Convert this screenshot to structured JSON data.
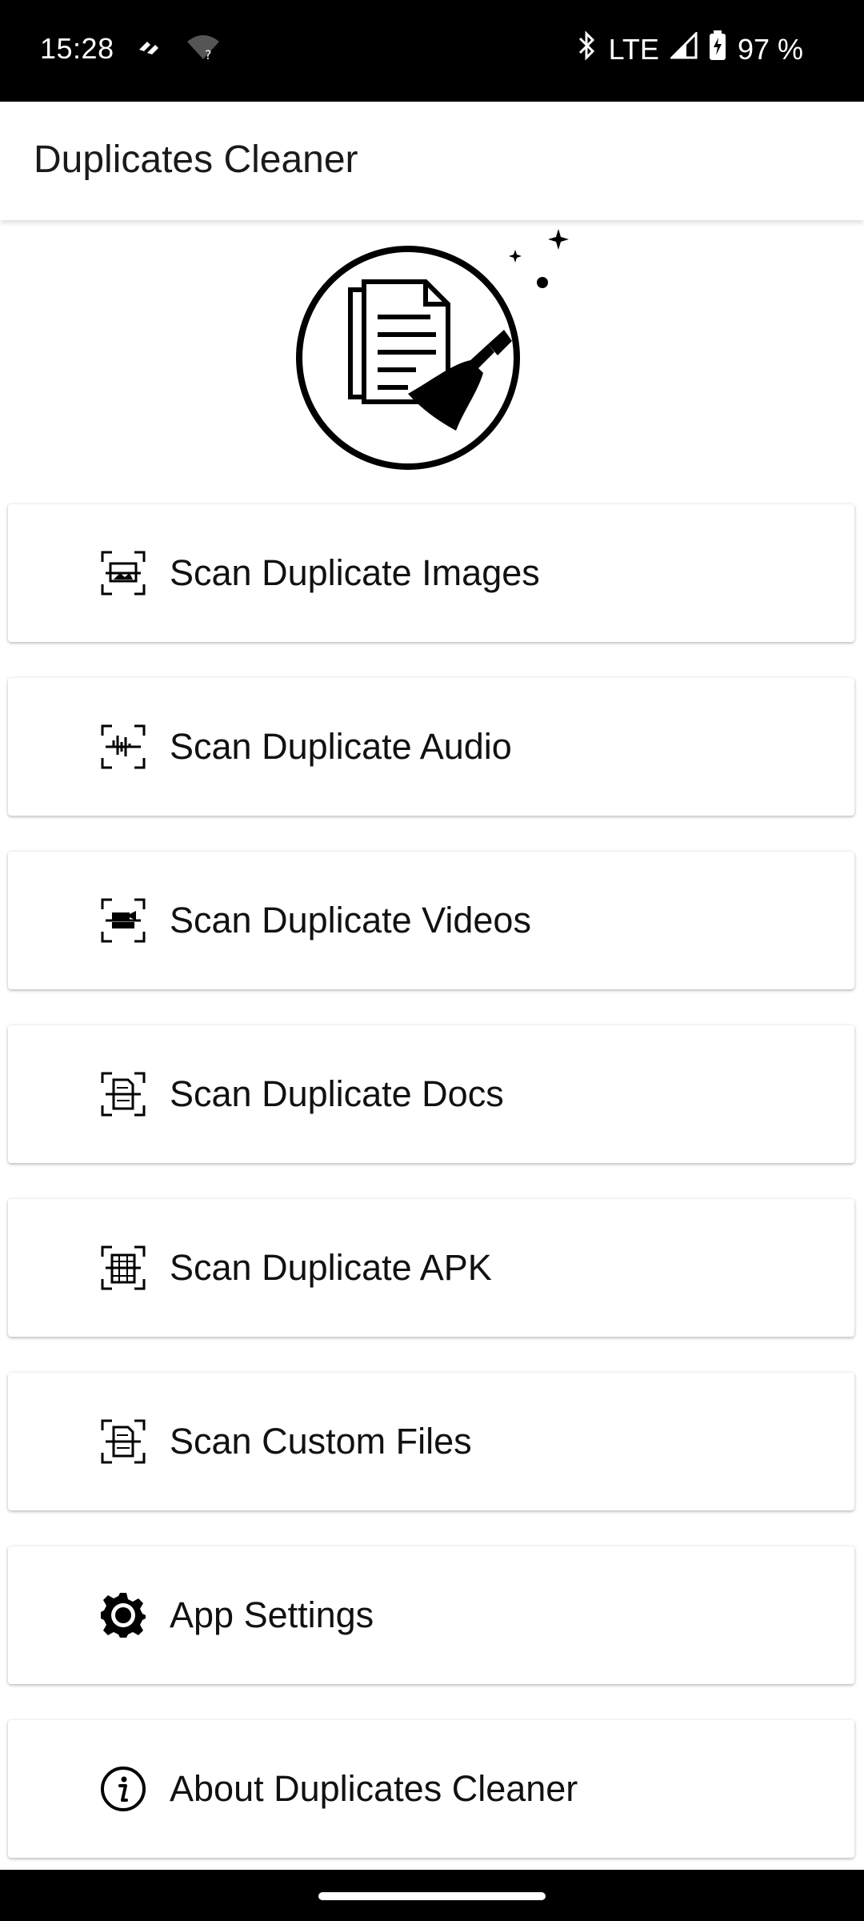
{
  "status_bar": {
    "time": "15:28",
    "network": "LTE",
    "battery": "97 %",
    "icons": [
      "network-activity-icon",
      "wifi-unknown-icon",
      "bluetooth-icon",
      "signal-icon",
      "battery-charging-icon"
    ]
  },
  "app_bar": {
    "title": "Duplicates Cleaner"
  },
  "logo": {
    "icon": "duplicate-documents-broom-icon"
  },
  "menu": {
    "items": [
      {
        "label": "Scan Duplicate Images",
        "icon": "scan-images-icon"
      },
      {
        "label": "Scan Duplicate Audio",
        "icon": "scan-audio-icon"
      },
      {
        "label": "Scan Duplicate Videos",
        "icon": "scan-videos-icon"
      },
      {
        "label": "Scan Duplicate Docs",
        "icon": "scan-docs-icon"
      },
      {
        "label": "Scan Duplicate APK",
        "icon": "scan-apk-icon"
      },
      {
        "label": "Scan Custom Files",
        "icon": "scan-custom-files-icon"
      },
      {
        "label": "App Settings",
        "icon": "gear-icon"
      },
      {
        "label": "About Duplicates Cleaner",
        "icon": "info-icon"
      }
    ]
  },
  "colors": {
    "status_bar": "#000000",
    "background": "#ffffff",
    "text": "#111111"
  }
}
